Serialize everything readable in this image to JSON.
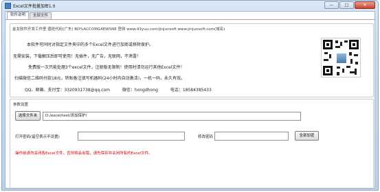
{
  "window": {
    "title": "Excel文件批量加密1.0",
    "minimize": "—",
    "maximize": "□",
    "close": "✕"
  },
  "tabs": [
    {
      "label": "软件说明"
    },
    {
      "label": "全部文件"
    }
  ],
  "info": {
    "line1": "金龙软件开发工作室 值班代码(广东) BD%ACCOMG4EWSNE 官网 www.43yuu.com/jinjunsoft  www.jinjunsoft.com(域名)",
    "line2": "本软件可同时对指定文件夹中的多个Excel文件进行加密或移除保护。",
    "line3": "无需安装，下载解压后即可使用！无插件，无广告，无联网，不泄露！",
    "line4": "免费版一次只能处理3个excel文件，注册版无限制！使用时请勿运行其他Excel文件！",
    "line5": "扫描微信二维码付款18元，转账备注填写机器码(24小时内自动激活)，一机一码，永久有效。",
    "line6_label1": "QQ、邮箱、支付宝：",
    "line6_value1": "3320931738@qq.com",
    "line6_label2": "微信：",
    "line6_value2": "hongdhong",
    "line6_label3": "电话：",
    "line6_value3": "18584385433"
  },
  "settings": {
    "group_title": "参数设置",
    "select_folder_button": "选择文件夹",
    "folder_path": "D:/excel/test/添加保护/",
    "open_password_label": "打开密码(留空表示不设置)",
    "open_password_value": "",
    "modify_password_label": "修改密码",
    "modify_password_value": "",
    "encrypt_all_button": "全部加密",
    "warning": "操作前请勿关闭各Excel文件，否则将会出错，请先保存并关闭所有的Excel文件。"
  },
  "colors": {
    "titlebar": "#c6d9ee",
    "warning_text": "#d40000",
    "close_button": "#c8452f"
  }
}
